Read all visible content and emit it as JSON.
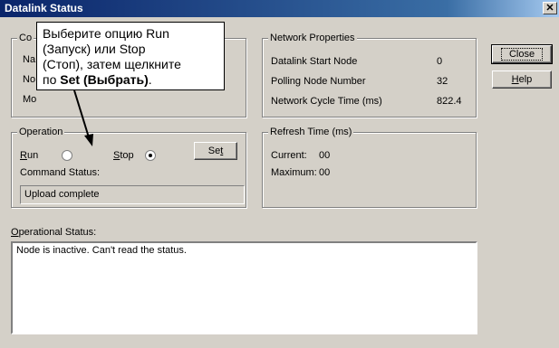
{
  "window": {
    "title": "Datalink Status",
    "close_glyph": "✕"
  },
  "connection": {
    "legend": "Co",
    "rows": [
      "Na",
      "No",
      "Mo"
    ]
  },
  "callout": {
    "line1": "Выберите опцию Run",
    "line2": "(Запуск) или Stop",
    "line3": "(Стоп), затем щелкните",
    "line4_prefix": "по ",
    "line4_bold": "Set (Выбрать)",
    "line4_suffix": "."
  },
  "network": {
    "legend": "Network Properties",
    "rows": [
      {
        "label": "Datalink Start Node",
        "value": "0"
      },
      {
        "label": "Polling Node Number",
        "value": "32"
      },
      {
        "label": "Network Cycle Time (ms)",
        "value": "822.4"
      }
    ]
  },
  "operation": {
    "legend": "Operation",
    "run_label_u": "R",
    "run_label_rest": "un",
    "stop_label_u": "S",
    "stop_label_rest": "top",
    "selected": "stop",
    "set_label_pre": "Se",
    "set_label_u": "t",
    "command_status_label": "Command Status:",
    "command_status_value": "Upload complete"
  },
  "refresh": {
    "legend": "Refresh Time (ms)",
    "current_label": "Current:",
    "current_value": "00",
    "maximum_label": "Maximum:",
    "maximum_value": "00"
  },
  "buttons": {
    "close": "Close",
    "help_u": "H",
    "help_rest": "elp"
  },
  "operational_status": {
    "label_u": "O",
    "label_rest": "perational Status:",
    "text": "Node is inactive. Can't read the status."
  }
}
